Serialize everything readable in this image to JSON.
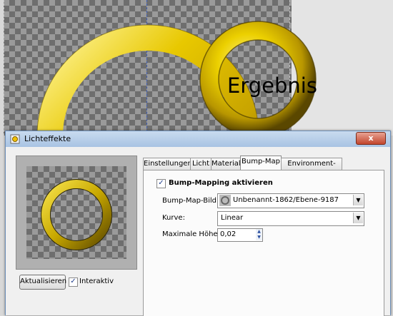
{
  "dialog": {
    "title": "Lichteffekte",
    "close_label": "x",
    "update_button": "Aktualisieren",
    "interactive_label": "Interaktiv",
    "interactive_checked": true
  },
  "annotation": {
    "result_label": "Ergebnis"
  },
  "tabs": [
    {
      "label": "Einstellungen",
      "active": false
    },
    {
      "label": "Licht",
      "active": false
    },
    {
      "label": "Material",
      "active": false
    },
    {
      "label": "Bump-Map",
      "active": true
    },
    {
      "label": "Environment-Map",
      "active": false
    }
  ],
  "bump_map": {
    "enable_label": "Bump-Mapping aktivieren",
    "enable_checked": true,
    "image_label": "Bump-Map-Bild:",
    "image_value": "Unbenannt-1862/Ebene-9187",
    "curve_label": "Kurve:",
    "curve_value": "Linear",
    "max_height_label": "Maximale Höhe:",
    "max_height_value": "0,02"
  },
  "colors": {
    "ring_gold": "#e8c800",
    "ring_dark": "#7a6400",
    "title_bar": "#b8cfe9",
    "close_red": "#c2452d"
  },
  "icons": {
    "app": "lighting-effects-icon",
    "close": "close-icon",
    "thumb": "image-thumbnail-icon"
  }
}
